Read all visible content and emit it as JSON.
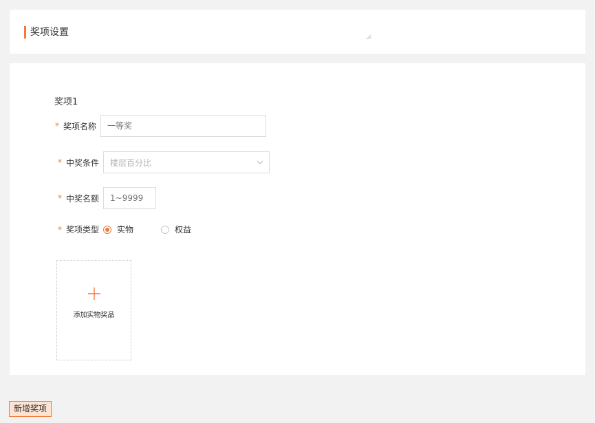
{
  "header": {
    "title": "奖项设置"
  },
  "prize": {
    "title": "奖项1",
    "required_mark": "*",
    "name": {
      "label": "奖项名称",
      "placeholder": "一等奖",
      "value": ""
    },
    "condition": {
      "label": "中奖条件",
      "selected": "楼层百分比"
    },
    "quota": {
      "label": "中奖名额",
      "placeholder": "1~9999",
      "value": ""
    },
    "type": {
      "label": "奖项类型",
      "options": [
        {
          "label": "实物",
          "checked": true
        },
        {
          "label": "权益",
          "checked": false
        }
      ]
    },
    "upload": {
      "label": "添加实物奖品"
    }
  },
  "footer": {
    "add_label": "新增奖项"
  },
  "colors": {
    "accent": "#f07a3b",
    "page_bg": "#f2f2f2",
    "add_button_bg": "#fde3d0"
  },
  "icons": {
    "select_arrow": "chevron-down-icon",
    "upload": "plus-icon",
    "resize": "resize-handle-icon"
  }
}
